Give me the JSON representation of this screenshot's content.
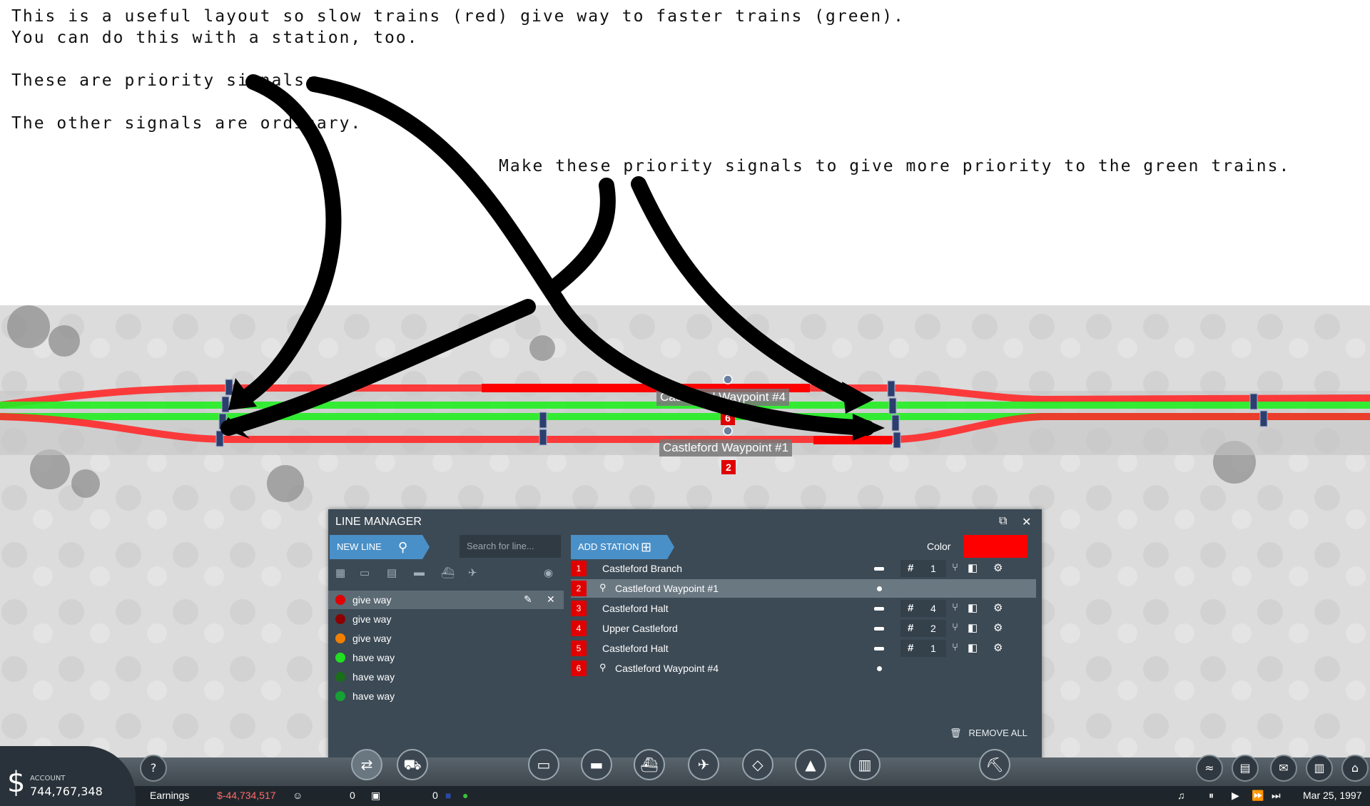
{
  "notes": {
    "line1": "This is a useful layout so slow trains (red) give way to faster trains (green).",
    "line2": "You can do this with a station, too.",
    "line3": "These are priority signals:",
    "line4": "The other signals are ordinary.",
    "line5": "Make these priority signals to give more priority to the green trains."
  },
  "map": {
    "waypoint_top_label": "Castleford Waypoint #4",
    "waypoint_top_num": "6",
    "waypoint_bottom_label": "Castleford Waypoint #1",
    "waypoint_bottom_num": "2"
  },
  "line_manager": {
    "title": "LINE MANAGER",
    "new_line": "NEW LINE",
    "search_placeholder": "Search for line...",
    "add_station": "ADD STATION",
    "color_label": "Color",
    "color_value": "#ff0000",
    "remove_all": "REMOVE ALL",
    "lines": [
      {
        "name": "give way",
        "color": "#e00000"
      },
      {
        "name": "give way",
        "color": "#8b0000"
      },
      {
        "name": "give way",
        "color": "#f08000"
      },
      {
        "name": "have way",
        "color": "#22dd22"
      },
      {
        "name": "have way",
        "color": "#1a6e1a"
      },
      {
        "name": "have way",
        "color": "#16a035"
      }
    ],
    "stops": [
      {
        "num": "1",
        "name": "Castleford Branch",
        "tracks": "1"
      },
      {
        "num": "2",
        "name": "Castleford Waypoint #1"
      },
      {
        "num": "3",
        "name": "Castleford Halt",
        "tracks": "4"
      },
      {
        "num": "4",
        "name": "Upper Castleford",
        "tracks": "2"
      },
      {
        "num": "5",
        "name": "Castleford Halt",
        "tracks": "1"
      },
      {
        "num": "6",
        "name": "Castleford Waypoint #4"
      }
    ]
  },
  "bottom": {
    "account_label": "ACCOUNT",
    "account_value": "744,767,348",
    "earnings_label": "Earnings",
    "earnings_value": "$-44,734,517",
    "passengers": "0",
    "cargo": "0",
    "date": "Mar 25, 1997"
  }
}
